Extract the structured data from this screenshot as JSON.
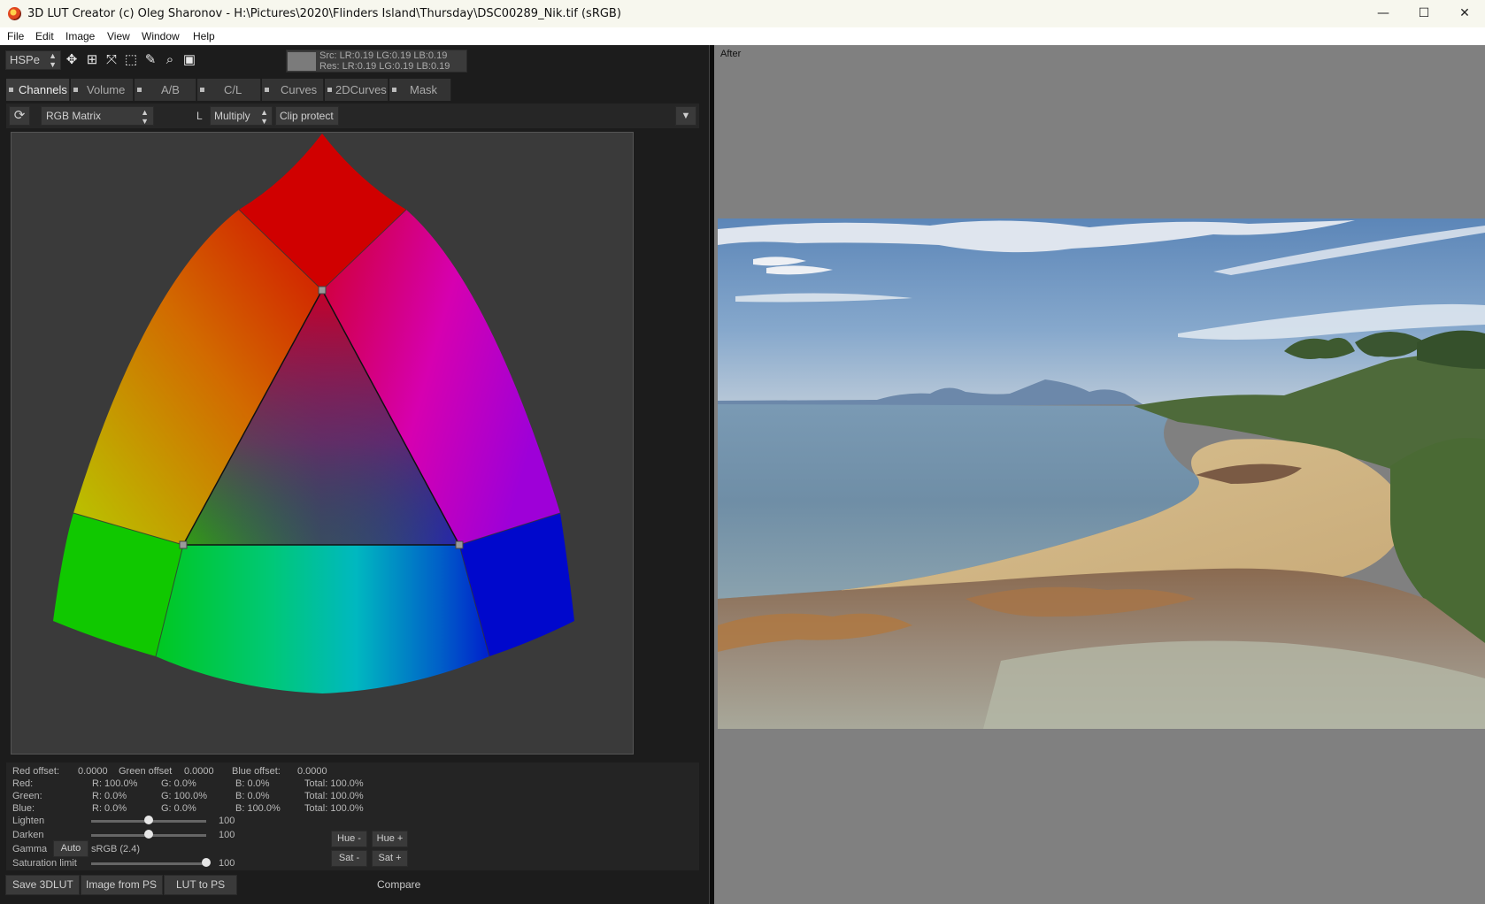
{
  "window": {
    "title": "3D LUT Creator (c) Oleg Sharonov - H:\\Pictures\\2020\\Flinders Island\\Thursday\\DSC00289_Nik.tif (sRGB)",
    "minimize": "—",
    "maximize": "☐",
    "close": "✕"
  },
  "menu": [
    "File",
    "Edit",
    "Image",
    "View",
    "Window",
    "Help"
  ],
  "toolbar": {
    "mode_select": "HSPe",
    "src_readout": "Src: LR:0.19 LG:0.19 LB:0.19",
    "res_readout": "Res: LR:0.19 LG:0.19 LB:0.19",
    "icons": [
      "move-icon",
      "fit-icon",
      "collapse-icon",
      "selection-icon",
      "eyedropper-icon",
      "zoom-icon",
      "frame-icon"
    ]
  },
  "tabs": [
    "Channels",
    "Volume",
    "A/B",
    "C/L",
    "Curves",
    "2DCurves",
    "Mask"
  ],
  "active_tab": "Channels",
  "channel_toolbar": {
    "matrix_select": "RGB Matrix",
    "l_label": "L",
    "blend_select": "Multiply",
    "clip_button": "Clip protect"
  },
  "params": {
    "red_offset_label": "Red offset:",
    "red_offset": "0.0000",
    "green_offset_label": "Green offset",
    "green_offset": "0.0000",
    "blue_offset_label": "Blue offset:",
    "blue_offset": "0.0000",
    "rows": [
      {
        "label": "Red:",
        "r": "R: 100.0%",
        "g": "G: 0.0%",
        "b": "B: 0.0%",
        "total": "Total: 100.0%"
      },
      {
        "label": "Green:",
        "r": "R: 0.0%",
        "g": "G: 100.0%",
        "b": "B: 0.0%",
        "total": "Total: 100.0%"
      },
      {
        "label": "Blue:",
        "r": "R: 0.0%",
        "g": "G: 0.0%",
        "b": "B: 100.0%",
        "total": "Total: 100.0%"
      }
    ],
    "lighten_label": "Lighten",
    "lighten_value": "100",
    "lighten_level": 0.5,
    "darken_label": "Darken",
    "darken_value": "100",
    "darken_level": 0.5,
    "gamma_label": "Gamma",
    "gamma_auto": "Auto",
    "gamma_value": "sRGB (2.4)",
    "saturation_label": "Saturation limit",
    "saturation_value": "100",
    "saturation_level": 1.0,
    "hue_minus": "Hue -",
    "hue_plus": "Hue +",
    "sat_minus": "Sat -",
    "sat_plus": "Sat +"
  },
  "bottom": {
    "save_3dlut": "Save 3DLUT",
    "image_from_ps": "Image from PS",
    "lut_to_ps": "LUT to PS",
    "compare": "Compare"
  },
  "preview": {
    "label": "After"
  }
}
